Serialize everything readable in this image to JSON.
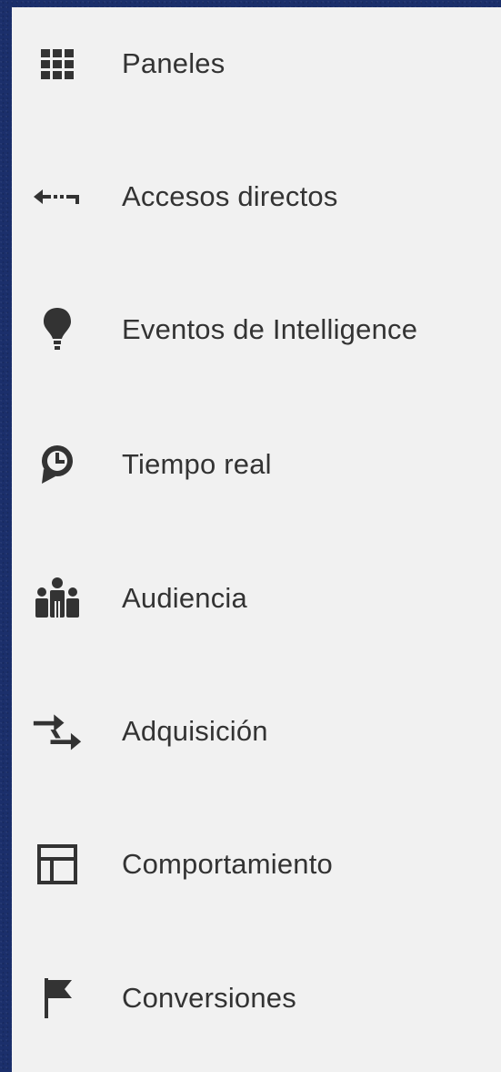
{
  "nav": {
    "items": [
      {
        "label": "Paneles",
        "icon": "grid-icon"
      },
      {
        "label": "Accesos directos",
        "icon": "shortcut-arrow-icon"
      },
      {
        "label": "Eventos de Intelligence",
        "icon": "lightbulb-icon"
      },
      {
        "label": "Tiempo real",
        "icon": "clock-icon"
      },
      {
        "label": "Audiencia",
        "icon": "people-icon"
      },
      {
        "label": "Adquisición",
        "icon": "acquisition-arrows-icon"
      },
      {
        "label": "Comportamiento",
        "icon": "layout-icon"
      },
      {
        "label": "Conversiones",
        "icon": "flag-icon"
      }
    ]
  },
  "colors": {
    "panel_background": "#f1f1f1",
    "outer_background": "#1b2f6b",
    "text": "#333333",
    "icon": "#333333"
  }
}
